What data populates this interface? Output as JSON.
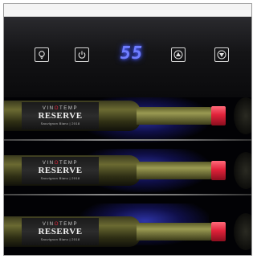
{
  "control_panel": {
    "buttons": [
      {
        "name": "light-button",
        "icon": "lightbulb-icon"
      },
      {
        "name": "power-button",
        "icon": "power-icon"
      },
      {
        "name": "temp-up-button",
        "icon": "triangle-up-icon"
      },
      {
        "name": "temp-down-button",
        "icon": "triangle-down-icon"
      }
    ],
    "display_value": "55",
    "display_color": "#6f7dff"
  },
  "shelves": [
    {
      "label": {
        "brand_pre": "VIN",
        "brand_dot": "O",
        "brand_post": "TEMP",
        "reserve": "RESERVE",
        "variety": "Sauvignon Blanc | 2018"
      }
    },
    {
      "label": {
        "brand_pre": "VIN",
        "brand_dot": "O",
        "brand_post": "TEMP",
        "reserve": "RESERVE",
        "variety": "Sauvignon Blanc | 2018"
      }
    },
    {
      "label": {
        "brand_pre": "VIN",
        "brand_dot": "O",
        "brand_post": "TEMP",
        "reserve": "RESERVE",
        "variety": "Sauvignon Blanc | 2018"
      }
    }
  ],
  "colors": {
    "accent_led": "#6f7dff",
    "cap_red": "#e0223a",
    "shelf_glow": "#4a5cff"
  }
}
